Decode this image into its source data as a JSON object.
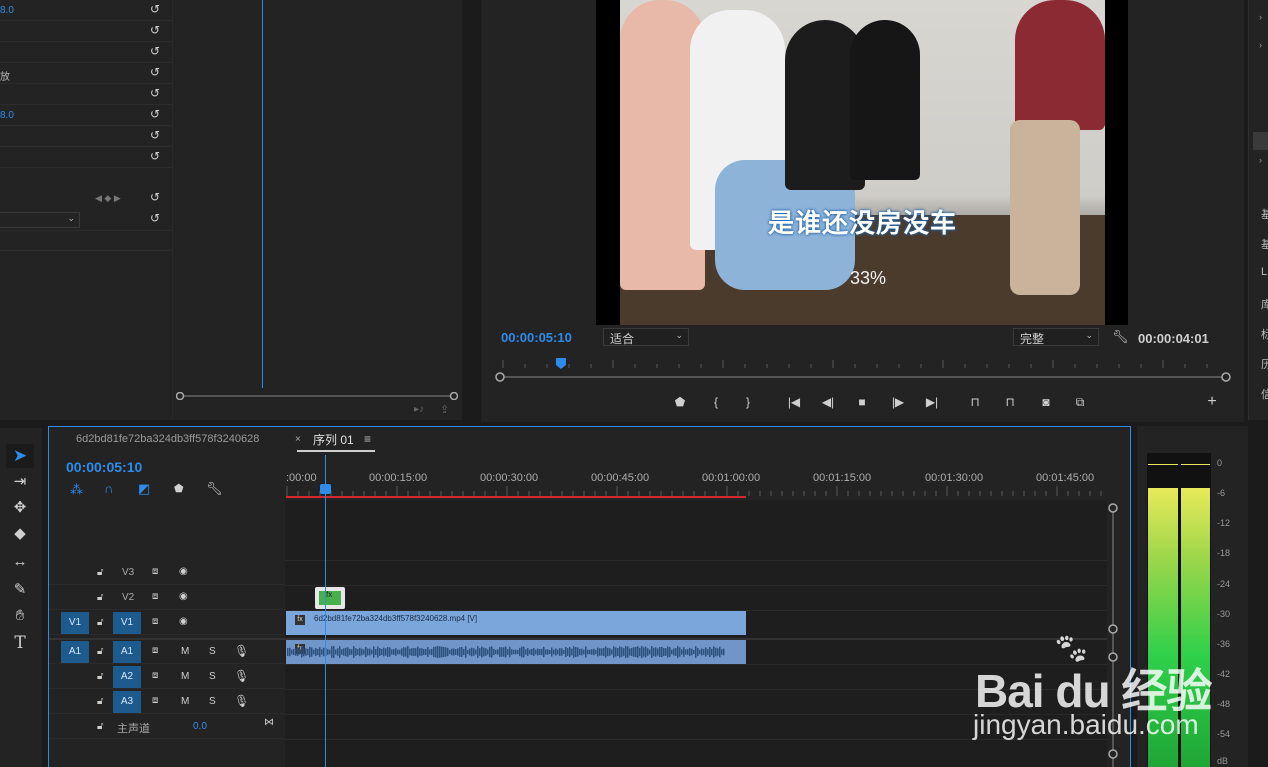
{
  "effect_controls": {
    "rows": [
      {
        "value": "8.0",
        "kind": "value"
      },
      {
        "value": "",
        "kind": "empty"
      },
      {
        "value": "",
        "kind": "empty"
      },
      {
        "value": "放",
        "kind": "text"
      },
      {
        "value": "",
        "kind": "empty"
      },
      {
        "value": "8.0",
        "kind": "value"
      },
      {
        "value": "",
        "kind": "empty"
      },
      {
        "value": "",
        "kind": "empty"
      }
    ]
  },
  "program_monitor": {
    "subtitle": "是谁还没房没车",
    "overlay_percent": "33%",
    "current_timecode": "00:00:05:10",
    "fit_dropdown": "适合",
    "quality_dropdown": "完整",
    "duration_timecode": "00:00:04:01",
    "playhead_progress": 0.084
  },
  "right_strip": {
    "labels": [
      "基",
      "基",
      "L",
      "库",
      "标",
      "历",
      "信"
    ]
  },
  "timeline": {
    "source_tab": "6d2bd81fe72ba324db3ff578f3240628",
    "sequence_tab": "序列 01",
    "timecode": "00:00:05:10",
    "ruler_labels": [
      ":00:00",
      "00:00:15:00",
      "00:00:30:00",
      "00:00:45:00",
      "00:01:00:00",
      "00:01:15:00",
      "00:01:30:00",
      "00:01:45:00"
    ],
    "tracks": {
      "v3": "V3",
      "v2": "V2",
      "v1": "V1",
      "v1_src": "V1",
      "a1": "A1",
      "a1_src": "A1",
      "a2": "A2",
      "a3": "A3",
      "mute": "M",
      "solo": "S"
    },
    "master_label": "主声道",
    "master_value": "0.0",
    "video_clip_name": "6d2bd81fe72ba324db3ff578f3240628.mp4 [V]",
    "fx_badge": "fx"
  },
  "audio_meter": {
    "db_labels": [
      "0",
      "-6",
      "-12",
      "-18",
      "-24",
      "-30",
      "-36",
      "-42",
      "-48",
      "-54",
      "dB"
    ]
  },
  "watermark": {
    "brand": "Bai du 经验",
    "url": "jingyan.baidu.com"
  },
  "colors": {
    "accent": "#2d8ceb",
    "clip_video": "#7aa6dc",
    "clip_audio": "#6f95c9",
    "work_area": "#d4282a",
    "meter_green": "#2fd04a",
    "meter_yellow": "#e8ea5a"
  }
}
